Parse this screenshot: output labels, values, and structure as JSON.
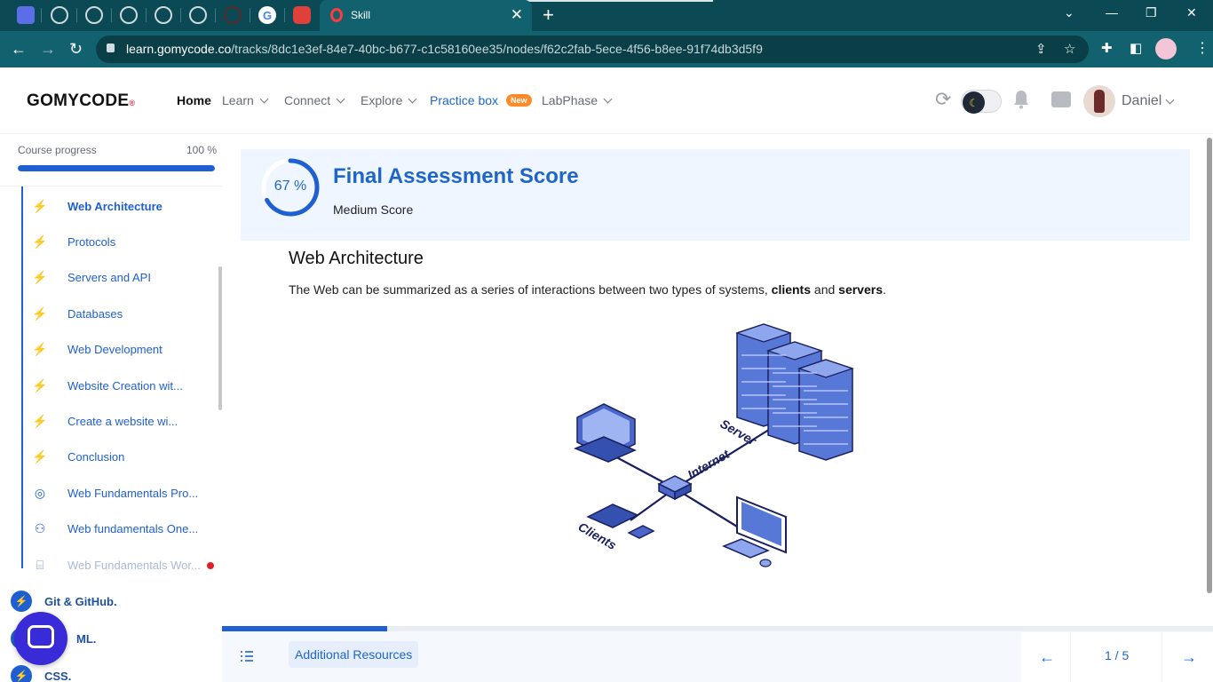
{
  "browser": {
    "active_tab_title": "Skill",
    "url_host": "learn.gomycode.co",
    "url_path": "/tracks/8dc1e3ef-84e7-40bc-b677-c1c58160ee35/nodes/f62c2fab-5ece-4f56-b8ee-91f74db3d5f9"
  },
  "header": {
    "logo_text": "GOMYCODE",
    "nav": [
      {
        "label": "Home"
      },
      {
        "label": "Learn"
      },
      {
        "label": "Connect"
      },
      {
        "label": "Explore"
      },
      {
        "label": "Practice box"
      },
      {
        "label": "LabPhase"
      }
    ],
    "new_badge": "New",
    "user_name": "Daniel"
  },
  "sidebar": {
    "progress_label": "Course progress",
    "progress_value": "100 %",
    "progress_fraction": 1.0,
    "items": [
      {
        "label": "Web Architecture",
        "icon": "bolt-icon"
      },
      {
        "label": "Protocols",
        "icon": "bolt-icon"
      },
      {
        "label": "Servers and API",
        "icon": "bolt-icon"
      },
      {
        "label": "Databases",
        "icon": "bolt-icon"
      },
      {
        "label": "Web Development",
        "icon": "bolt-icon"
      },
      {
        "label": "Website Creation wit...",
        "icon": "bolt-icon"
      },
      {
        "label": "Create a website wi...",
        "icon": "bolt-icon"
      },
      {
        "label": "Conclusion",
        "icon": "bolt-icon"
      },
      {
        "label": "Web Fundamentals Pro...",
        "icon": "target-icon"
      },
      {
        "label": "Web fundamentals One...",
        "icon": "people-icon"
      },
      {
        "label": "Web Fundamentals Wor...",
        "icon": "workshop-icon"
      }
    ],
    "groups": [
      {
        "label": "Git & GitHub."
      },
      {
        "label": "ML."
      },
      {
        "label": "CSS."
      }
    ]
  },
  "score": {
    "percent_text": "67 %",
    "percent_value": 67,
    "title": "Final Assessment Score",
    "subtitle": "Medium Score"
  },
  "lesson": {
    "title": "Web Architecture",
    "text_prefix": "The Web can be summarized as a series of interactions between two types of systems, ",
    "text_bold1": "clients",
    "text_mid": " and ",
    "text_bold2": "servers",
    "text_suffix": ".",
    "illustration_labels": {
      "server": "Server",
      "internet": "Internet",
      "clients": "Clients"
    }
  },
  "footer": {
    "additional_resources": "Additional Resources",
    "page_indicator": "1 / 5",
    "progress_fraction": 0.167
  },
  "colors": {
    "brand_blue": "#1e5fd1",
    "accent_blue": "#1e66c8",
    "chrome_teal": "#11626e",
    "badge_orange": "#ff8a2a"
  }
}
